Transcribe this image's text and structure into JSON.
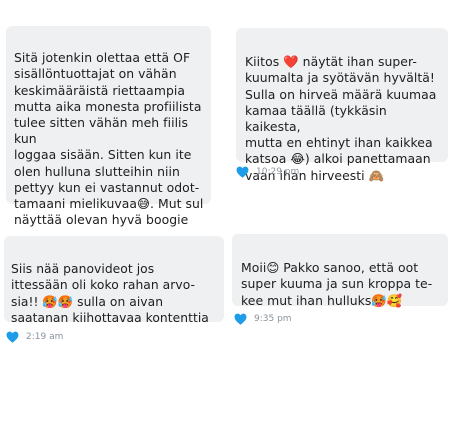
{
  "colors": {
    "bubble_bg": "#eef0f2",
    "like_heart": "#1f9ce8",
    "timestamp": "#8a939b"
  },
  "messages": [
    {
      "text": "Sitä jotenkin olettaa että OF\nsisällöntuottajat on vähän\nkeskimääräistä riettaampia\nmutta aika monesta profiilista\ntulee sitten vähän meh fiilis kun\nloggaa sisään. Sitten kun ite\nolen hulluna slutteihin niin\npettyy kun ei vastannut odot-\ntamaani mielikuvaa😅. Mut sul\nnäyttää olevan hyvä boogie",
      "time": ""
    },
    {
      "text": "Kiitos ❤️ näytät ihan super-\nkuumalta ja syötävän hyvältä!\nSulla on hirveä määrä kuumaa\nkamaa täällä (tykkäsin kaikesta,\nmutta en ehtinyt ihan kaikkea\nkatsoa 😂) alkoi panettamaan\nvaan ihan hirveesti 🙈",
      "time": "10:29 pm"
    },
    {
      "text": "Siis nää panovideot jos\nittessään oli koko rahan arvo-\nsia!! 🥵🥵 sulla on aivan\nsaatanan kiihottavaa kontenttia",
      "time": "2:19 am"
    },
    {
      "text": "Moii😊 Pakko sanoo, että oot\nsuper kuuma ja sun kroppa te-\nkee mut ihan hulluks🥵🥰",
      "time": "9:35 pm"
    }
  ]
}
